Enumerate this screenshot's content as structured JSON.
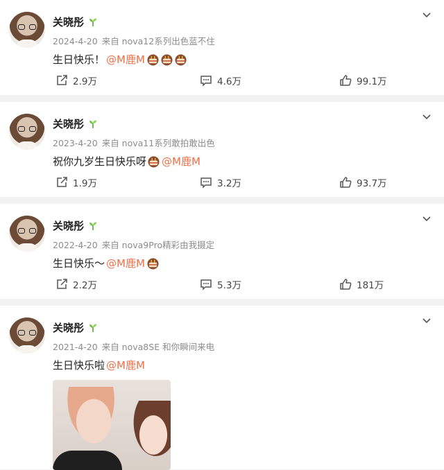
{
  "posts": [
    {
      "user": "关晓彤",
      "date": "2024-4-20",
      "source": "来自 nova12系列出色蓝不住",
      "text_before": "生日快乐！",
      "mention": "@M鹿M",
      "text_after": "",
      "cakes": 3,
      "reposts": "2.9万",
      "comments": "4.6万",
      "likes": "99.1万"
    },
    {
      "user": "关晓彤",
      "date": "2023-4-20",
      "source": "来自 nova11系列敢拍敢出色",
      "text_before": "祝你九岁生日快乐呀",
      "mention": "@M鹿M",
      "text_after": "",
      "cakes": 1,
      "reposts": "1.9万",
      "comments": "3.2万",
      "likes": "93.7万"
    },
    {
      "user": "关晓彤",
      "date": "2022-4-20",
      "source": "来自 nova9Pro精彩由我摄定",
      "text_before": "生日快乐～",
      "mention": "@M鹿M",
      "text_after": "",
      "cakes": 1,
      "reposts": "2.2万",
      "comments": "5.3万",
      "likes": "181万"
    },
    {
      "user": "关晓彤",
      "date": "2021-4-20",
      "source": "来自 nova8SE 和你瞬间来电",
      "text_before": "生日快乐啦",
      "mention": "@M鹿M",
      "text_after": "",
      "cakes": 0,
      "has_photo": true
    }
  ],
  "colors": {
    "mention": "#eb7350",
    "meta": "#8c8c8c",
    "divider": "#f2f2f2"
  }
}
